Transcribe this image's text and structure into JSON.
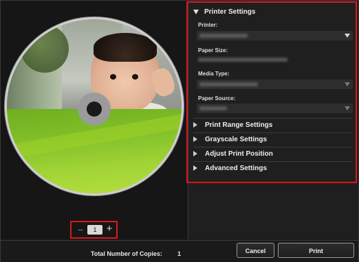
{
  "preview": {
    "copies_value": "1",
    "minus_symbol": "−",
    "plus_symbol": "+"
  },
  "settings": {
    "printer_section_title": "Printer Settings",
    "printer_label": "Printer:",
    "paper_size_label": "Paper Size:",
    "media_type_label": "Media Type:",
    "paper_source_label": "Paper Source:",
    "collapsed_sections": [
      "Print Range Settings",
      "Grayscale Settings",
      "Adjust Print Position",
      "Advanced Settings"
    ]
  },
  "footer": {
    "total_copies_label": "Total Number of Copies:",
    "total_copies_value": "1",
    "cancel_label": "Cancel",
    "print_label": "Print"
  },
  "colors": {
    "highlight": "#e0151b",
    "disc_green": "#83c12a"
  }
}
